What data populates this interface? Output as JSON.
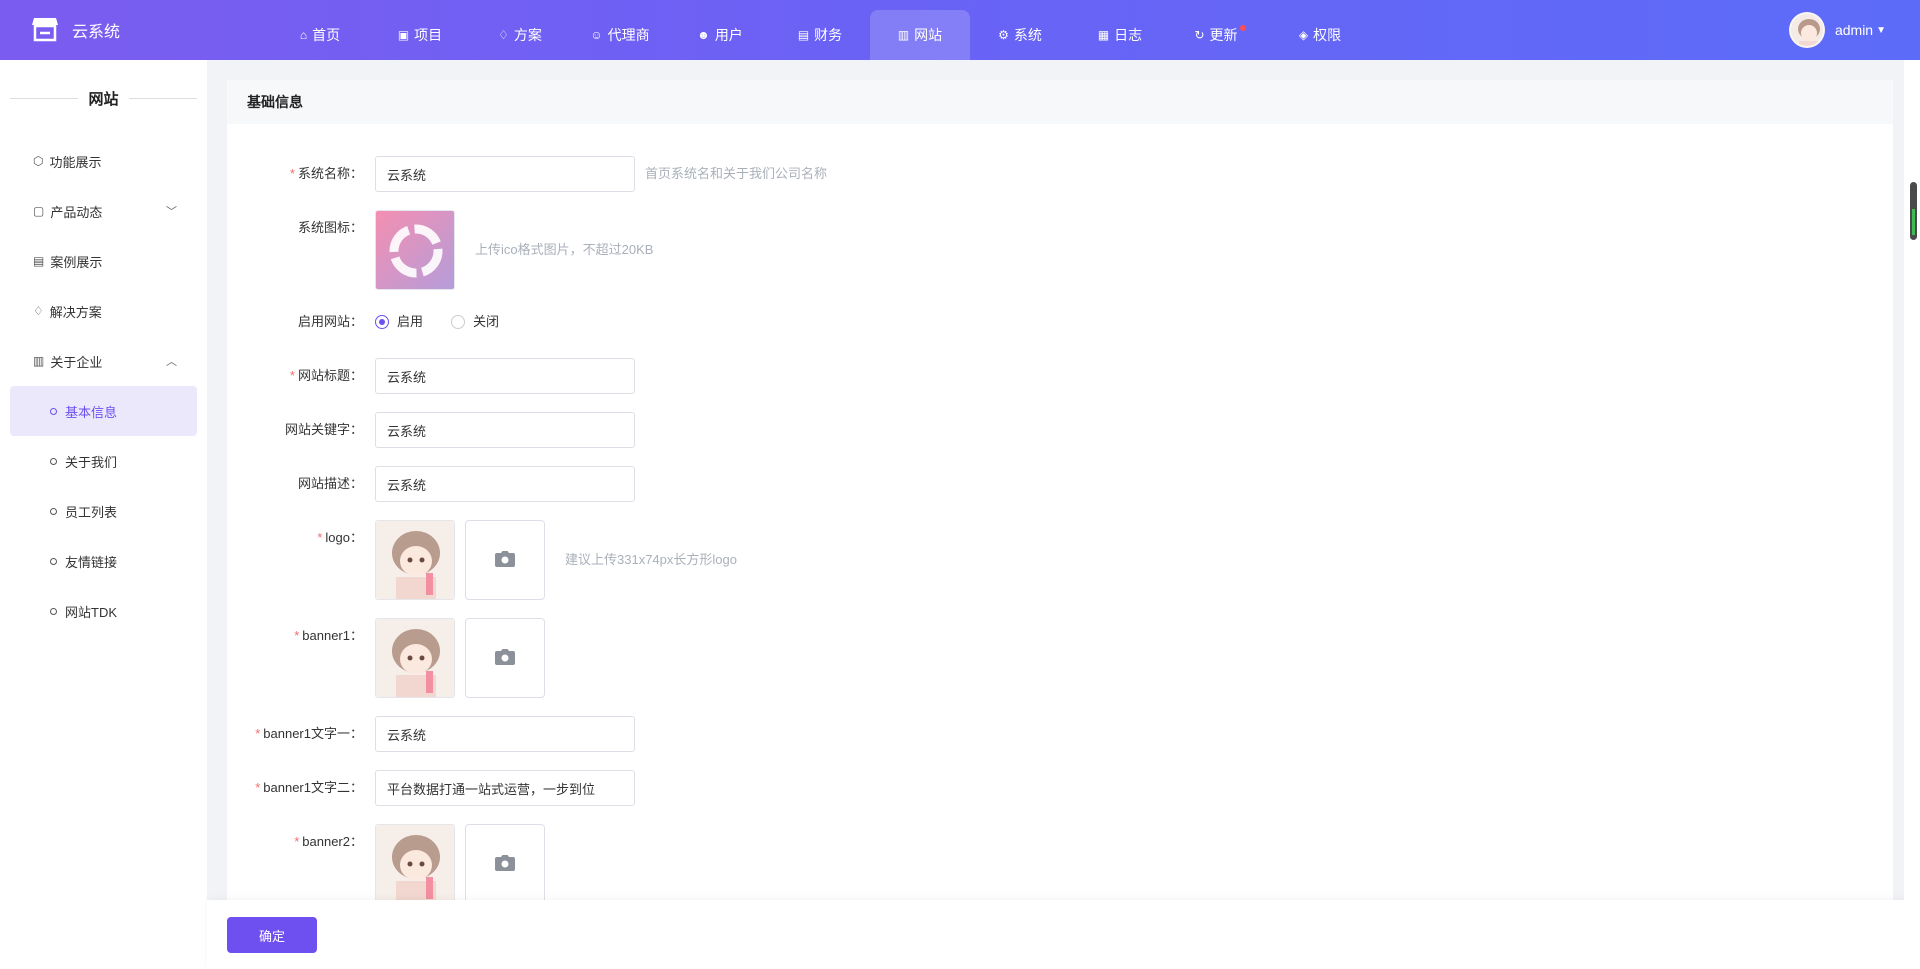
{
  "app": {
    "name": "云系统"
  },
  "nav": {
    "items": [
      {
        "icon": "home-icon",
        "glyph": "⌂",
        "label": "首页",
        "active": false
      },
      {
        "icon": "briefcase-icon",
        "glyph": "▣",
        "label": "项目",
        "active": false
      },
      {
        "icon": "diamond-icon",
        "glyph": "♢",
        "label": "方案",
        "active": false
      },
      {
        "icon": "agent-icon",
        "glyph": "☺",
        "label": "代理商",
        "active": false
      },
      {
        "icon": "users-icon",
        "glyph": "☻",
        "label": "用户",
        "active": false
      },
      {
        "icon": "finance-icon",
        "glyph": "▤",
        "label": "财务",
        "active": false
      },
      {
        "icon": "website-icon",
        "glyph": "▥",
        "label": "网站",
        "active": true
      },
      {
        "icon": "system-icon",
        "glyph": "⚙",
        "label": "系统",
        "active": false
      },
      {
        "icon": "log-icon",
        "glyph": "▦",
        "label": "日志",
        "active": false
      },
      {
        "icon": "refresh-icon",
        "glyph": "↻",
        "label": "更新",
        "active": false,
        "badge": true
      },
      {
        "icon": "shield-icon",
        "glyph": "◈",
        "label": "权限",
        "active": false
      }
    ]
  },
  "user": {
    "name": "admin"
  },
  "sidebar": {
    "title": "网站",
    "menu": [
      {
        "icon": "cube-icon",
        "glyph": "⬡",
        "label": "功能展示"
      },
      {
        "icon": "clipboard-icon",
        "glyph": "▢",
        "label": "产品动态",
        "arrow": "﹀"
      },
      {
        "icon": "cases-icon",
        "glyph": "▤",
        "label": "案例展示"
      },
      {
        "icon": "diamond-icon",
        "glyph": "♢",
        "label": "解决方案"
      },
      {
        "icon": "building-icon",
        "glyph": "▥",
        "label": "关于企业",
        "arrow": "︿"
      }
    ],
    "submenu": [
      {
        "label": "基本信息",
        "active": true
      },
      {
        "label": "关于我们",
        "active": false
      },
      {
        "label": "员工列表",
        "active": false
      },
      {
        "label": "友情链接",
        "active": false
      },
      {
        "label": "网站TDK",
        "active": false
      }
    ]
  },
  "card": {
    "title": "基础信息"
  },
  "form": {
    "system_name": {
      "label": "系统名称：",
      "value": "云系统",
      "hint": "首页系统名和关于我们公司名称"
    },
    "system_icon": {
      "label": "系统图标：",
      "hint": "上传ico格式图片，不超过20KB"
    },
    "enable_site": {
      "label": "启用网站：",
      "options": [
        "启用",
        "关闭"
      ],
      "selected": "启用"
    },
    "site_title": {
      "label": "网站标题：",
      "value": "云系统"
    },
    "site_keywords": {
      "label": "网站关键字：",
      "value": "云系统"
    },
    "site_description": {
      "label": "网站描述：",
      "value": "云系统"
    },
    "logo": {
      "label": "logo：",
      "hint": "建议上传331x74px长方形logo"
    },
    "banner1": {
      "label": "banner1："
    },
    "banner1_text1": {
      "label": "banner1文字一：",
      "value": "云系统"
    },
    "banner1_text2": {
      "label": "banner1文字二：",
      "value": "平台数据打通一站式运营，一步到位"
    },
    "banner2": {
      "label": "banner2："
    }
  },
  "footer": {
    "confirm_label": "确定"
  },
  "colors": {
    "accent": "#6e4ff0",
    "required": "#f56c6c",
    "hint": "#aab0ba"
  }
}
